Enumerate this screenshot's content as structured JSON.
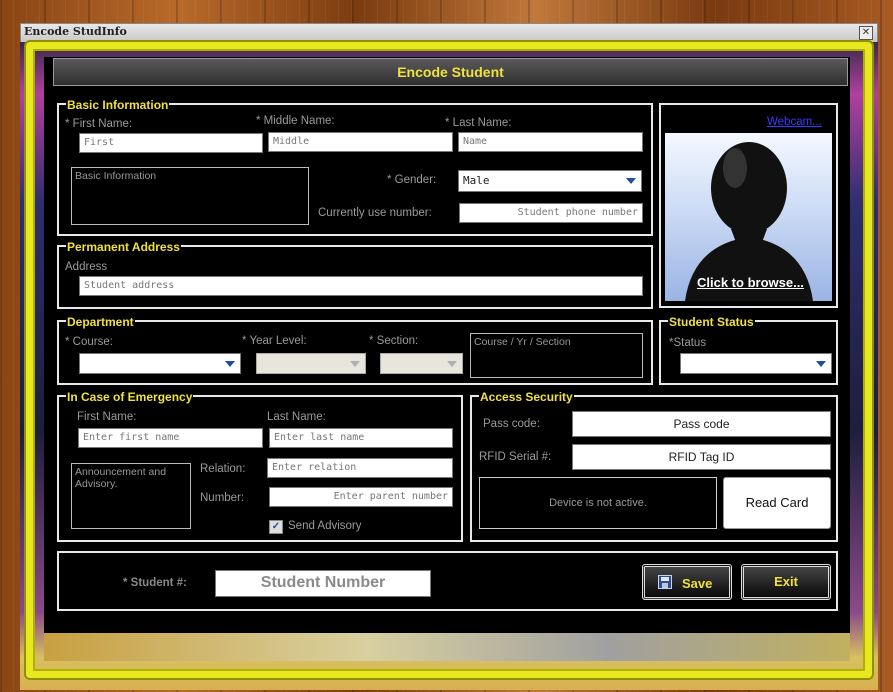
{
  "window": {
    "title": "Encode StudInfo",
    "close_glyph": "✕"
  },
  "header": {
    "title": "Encode Student"
  },
  "basic": {
    "title": "Basic Information",
    "first_label": "* First Name:",
    "middle_label": "* Middle Name:",
    "last_label": "* Last Name:",
    "first_placeholder": "First",
    "middle_placeholder": "Middle",
    "last_placeholder": "Name",
    "info_box": "Basic Information",
    "gender_label": "* Gender:",
    "gender_value": "Male",
    "phone_label": "Currently use number:",
    "phone_placeholder": "Student phone number"
  },
  "photo": {
    "webcam_link": "Webcam...",
    "browse_text": "Click to browse..."
  },
  "address": {
    "title": "Permanent Address",
    "label": "Address",
    "placeholder": "Student address"
  },
  "department": {
    "title": "Department",
    "course_label": "* Course:",
    "year_label": "* Year Level:",
    "section_label": "* Section:",
    "summary_box": "Course / Yr / Section"
  },
  "status": {
    "title": "Student Status",
    "label": "*Status"
  },
  "emergency": {
    "title": "In Case of Emergency",
    "first_label": "First Name:",
    "last_label": "Last Name:",
    "first_placeholder": "Enter first name",
    "last_placeholder": "Enter last name",
    "advisory_box": "Announcement and Advisory.",
    "relation_label": "Relation:",
    "relation_placeholder": "Enter relation",
    "number_label": "Number:",
    "number_placeholder": "Enter parent number",
    "send_advisory_label": "Send Advisory",
    "checkbox_glyph": "✓"
  },
  "access": {
    "title": "Access Security",
    "passcode_label": "Pass code:",
    "passcode_value": "Pass code",
    "rfid_label": "RFID Serial #:",
    "rfid_value": "RFID Tag ID",
    "device_status": "Device is not active.",
    "read_card_button": "Read Card"
  },
  "footer": {
    "student_num_label": "* Student #:",
    "student_num_placeholder": "Student Number",
    "save_button": "Save",
    "exit_button": "Exit"
  },
  "colors": {
    "accent_yellow": "#f0e040",
    "link_blue": "#3b3bff",
    "frame_yellow": "#e8e820"
  },
  "icons": {
    "save": "floppy-disk-icon",
    "dropdown": "chevron-down-icon",
    "close": "close-icon",
    "avatar": "person-silhouette-icon"
  }
}
